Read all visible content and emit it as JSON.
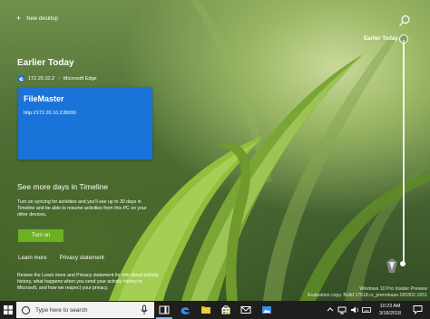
{
  "top_bar": {
    "new_desktop_label": "New desktop",
    "search_icon": "search-icon"
  },
  "scrubber": {
    "current_label": "Earlier Today"
  },
  "timeline": {
    "section_title": "Earlier Today",
    "activity": {
      "source_ip": "172.20.10.2",
      "separator": "-",
      "app_name": "Microsoft Edge",
      "card_title": "FileMaster",
      "card_url": "http://172.20.10.2:8000/",
      "card_color": "#1a73d8"
    },
    "promo": {
      "title": "See more days in Timeline",
      "body": "Turn on syncing for activities and you'll see up to 30 days in Timeline and be able to resume activities from this PC on your other devices.",
      "button_label": "Turn on",
      "button_color": "#6db022"
    },
    "links": {
      "learn_more": "Learn more",
      "privacy": "Privacy statement"
    },
    "review_text": "Review the Learn more and Privacy statement for info about activity history, what happens when you send your activity history to Microsoft, and how we respect your privacy."
  },
  "watermark": {
    "line1": "Windows 10 Pro Insider Preview",
    "line2": "Evaluation copy. Build 17618.rs_prerelease.180302-1651"
  },
  "taskbar": {
    "search_placeholder": "Type here to search",
    "pinned_icons": [
      "task-view-icon",
      "edge-icon",
      "file-explorer-icon",
      "store-icon",
      "mail-icon",
      "photos-icon"
    ],
    "clock_time": "10:23 AM",
    "clock_date": "3/16/2018",
    "accent_color": "#7fb1e6"
  }
}
